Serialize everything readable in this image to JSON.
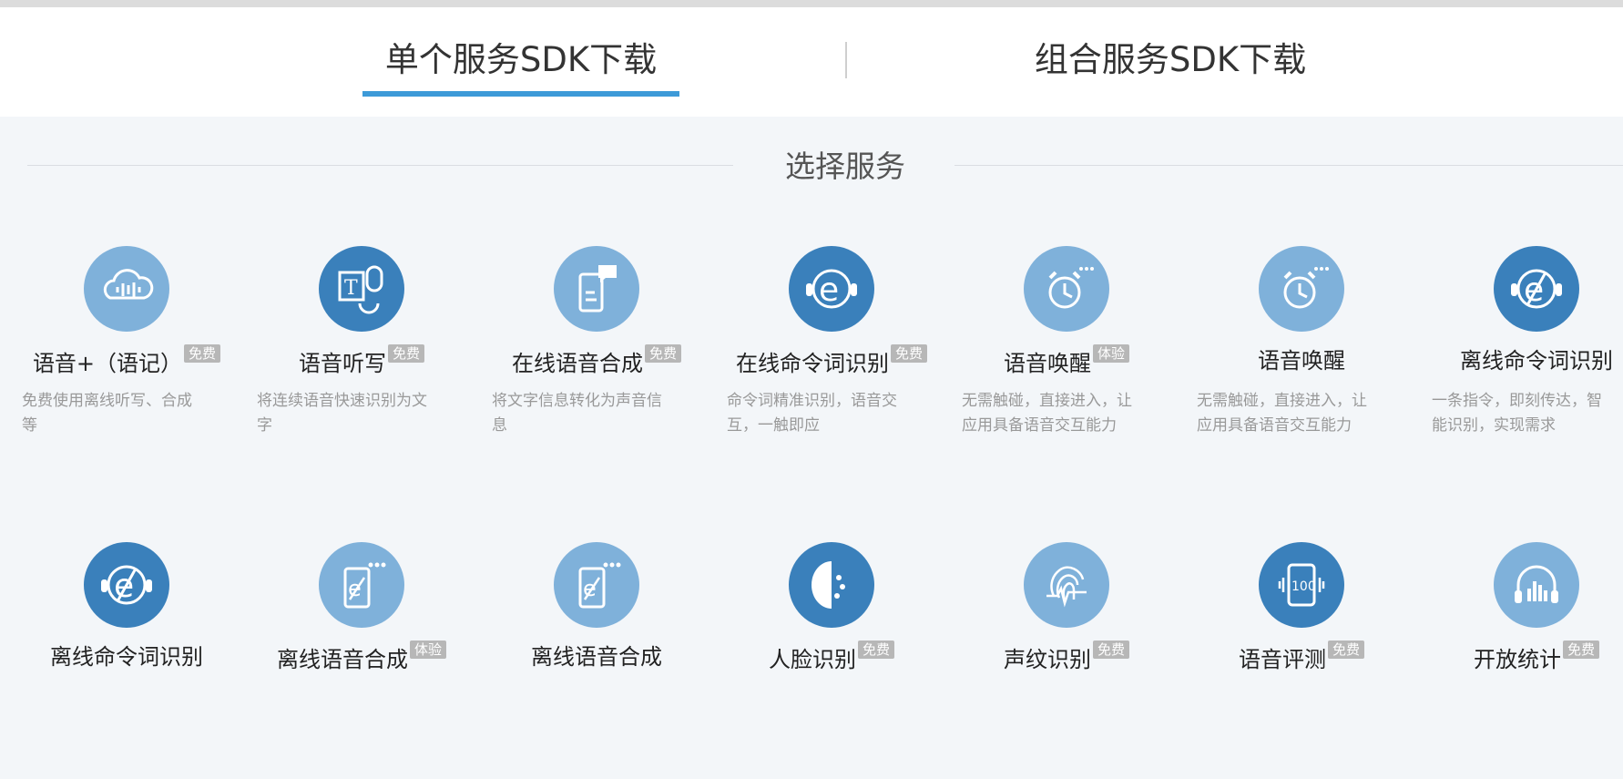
{
  "tabs": [
    {
      "label": "单个服务SDK下载",
      "active": true
    },
    {
      "label": "组合服务SDK下载",
      "active": false
    }
  ],
  "section_title": "选择服务",
  "accent_color": "#3d9ad8",
  "services": [
    {
      "name": "语音+（语记）",
      "badge": "免费",
      "desc": "免费使用离线听写、合成等",
      "icon": "cloud-voice-icon",
      "dark": false
    },
    {
      "name": "语音听写",
      "badge": "免费",
      "desc": "将连续语音快速识别为文字",
      "icon": "text-microphone-icon",
      "dark": true
    },
    {
      "name": "在线语音合成",
      "badge": "免费",
      "desc": "将文字信息转化为声音信息",
      "icon": "phone-chat-icon",
      "dark": false
    },
    {
      "name": "在线命令词识别",
      "badge": "免费",
      "desc": "命令词精准识别，语音交互，一触即应",
      "icon": "headset-e-icon",
      "dark": true
    },
    {
      "name": "语音唤醒",
      "badge": "体验",
      "desc": "无需触碰，直接进入，让应用具备语音交互能力",
      "icon": "alarm-clock-icon",
      "dark": false
    },
    {
      "name": "语音唤醒",
      "badge": "",
      "desc": "无需触碰，直接进入，让应用具备语音交互能力",
      "icon": "alarm-clock-icon",
      "dark": false
    },
    {
      "name": "离线命令词识别",
      "badge": "",
      "desc": "一条指令，即刻传达，智能识别，实现需求",
      "icon": "headset-offline-e-icon",
      "dark": true
    },
    {
      "name": "离线命令词识别",
      "badge": "",
      "desc": "",
      "icon": "headset-offline-e-icon",
      "dark": true
    },
    {
      "name": "离线语音合成",
      "badge": "体验",
      "desc": "",
      "icon": "phone-offline-e-icon",
      "dark": false
    },
    {
      "name": "离线语音合成",
      "badge": "",
      "desc": "",
      "icon": "phone-offline-e-icon",
      "dark": false
    },
    {
      "name": "人脸识别",
      "badge": "免费",
      "desc": "",
      "icon": "face-icon",
      "dark": true
    },
    {
      "name": "声纹识别",
      "badge": "免费",
      "desc": "",
      "icon": "fingerprint-icon",
      "dark": false
    },
    {
      "name": "语音评测",
      "badge": "免费",
      "desc": "",
      "icon": "phone-score-icon",
      "dark": true
    },
    {
      "name": "开放统计",
      "badge": "免费",
      "desc": "",
      "icon": "headphones-chart-icon",
      "dark": false
    }
  ]
}
